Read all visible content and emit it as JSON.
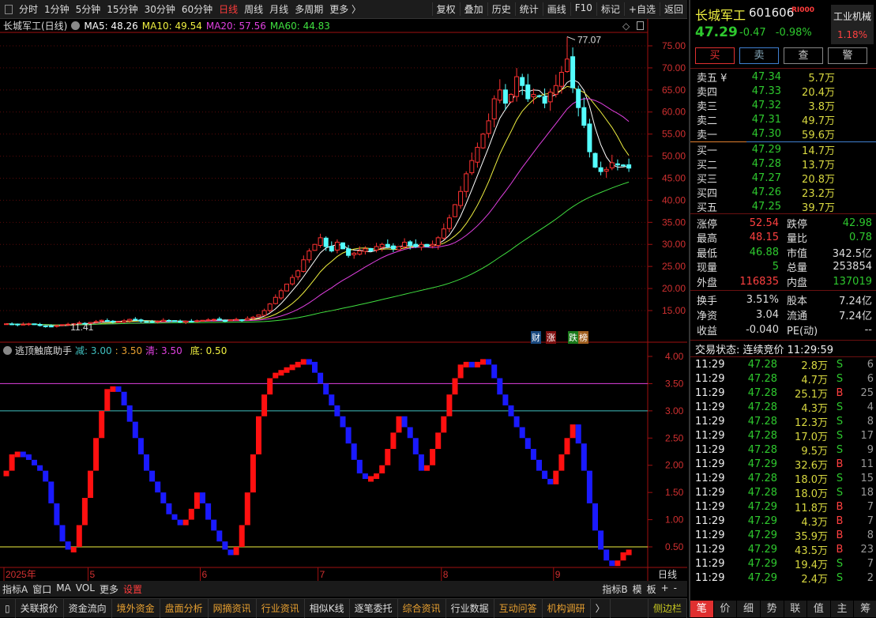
{
  "toolbar": {
    "periods": [
      "分时",
      "1分钟",
      "5分钟",
      "15分钟",
      "30分钟",
      "60分钟",
      "日线",
      "周线",
      "月线",
      "多周期",
      "更多 〉"
    ],
    "active": "日线",
    "actions": [
      "复权",
      "叠加",
      "历史",
      "统计",
      "画线",
      "F10",
      "标记",
      "+自选",
      "返回"
    ]
  },
  "title": {
    "name": "长城军工(日线)",
    "ma5": "MA5: 48.26",
    "ma10": "MA10: 49.54",
    "ma20": "MA20: 57.56",
    "ma60": "MA60: 44.83"
  },
  "indicator": {
    "name": "逃顶触底助手",
    "jian": "减: 3.00",
    "sep": ": 3.50",
    "qing": "清: 3.50",
    "di": "底: 0.50"
  },
  "badges": [
    "财",
    "涨",
    "跌",
    "榜"
  ],
  "colors": {
    "up": "#ff3232",
    "down": "#54ffff",
    "ma5": "#ffffff",
    "ma10": "#f0f040",
    "ma20": "#e040e0",
    "ma60": "#40e040",
    "axis": "#a01010"
  },
  "chart_data": [
    {
      "type": "candlestick",
      "title": "长城军工(日线)",
      "yticks": [
        75,
        70,
        65,
        60,
        55,
        50,
        45,
        40,
        35,
        30,
        25,
        20,
        15
      ],
      "ylim": [
        15,
        75
      ],
      "date_labels": [
        {
          "i": 0,
          "label": "2025年"
        },
        {
          "i": 15,
          "label": "5"
        },
        {
          "i": 35,
          "label": "6"
        },
        {
          "i": 56,
          "label": "7"
        },
        {
          "i": 78,
          "label": "8"
        },
        {
          "i": 98,
          "label": "9"
        }
      ],
      "period_label": "日线",
      "max_label": "77.07",
      "max_value": 77.07,
      "max_index": 100,
      "min_label": "11.41",
      "min_value": 11.41,
      "min_index": 12,
      "close": [
        12.0,
        11.9,
        11.8,
        11.9,
        12.0,
        11.8,
        11.6,
        11.5,
        11.4,
        11.6,
        11.8,
        11.9,
        12.0,
        12.2,
        12.1,
        12.3,
        12.5,
        12.8,
        12.6,
        12.4,
        12.5,
        12.7,
        13.0,
        12.8,
        12.6,
        12.5,
        12.4,
        12.6,
        12.8,
        12.7,
        12.5,
        12.4,
        12.6,
        12.5,
        12.7,
        12.8,
        12.9,
        13.0,
        12.8,
        12.7,
        12.9,
        13.0,
        12.9,
        13.2,
        13.5,
        14.0,
        15.0,
        16.5,
        18.0,
        19.5,
        21.0,
        22.5,
        24.0,
        26.5,
        28.5,
        30.0,
        31.5,
        29.5,
        28.5,
        30.5,
        29.0,
        27.5,
        28.0,
        28.5,
        29.0,
        28.5,
        29.5,
        30.0,
        29.5,
        29.0,
        29.5,
        30.5,
        29.8,
        29.5,
        30.0,
        29.5,
        30.0,
        31.5,
        33.5,
        36.0,
        39.0,
        42.0,
        46.0,
        49.0,
        52.0,
        55.0,
        58.0,
        63.0,
        65.0,
        62.0,
        64.0,
        68.0,
        66.0,
        63.0,
        64.0,
        63.5,
        62.0,
        64.5,
        66.0,
        69.0,
        72.0,
        65.5,
        61.0,
        57.0,
        51.0,
        47.5,
        46.5,
        47.0,
        48.5,
        48.0,
        47.8,
        47.29
      ]
    },
    {
      "type": "step",
      "title": "逃顶触底助手",
      "yticks": [
        4.0,
        3.5,
        3.0,
        2.5,
        2.0,
        1.5,
        1.0,
        0.5
      ],
      "ylim": [
        0.2,
        4.1
      ],
      "hlines": [
        {
          "v": 3.5,
          "color": "#e040e0"
        },
        {
          "v": 3.0,
          "color": "#40c0c0"
        },
        {
          "v": 0.5,
          "color": "#f0f040"
        }
      ],
      "values": [
        1.9,
        2.2,
        2.25,
        2.2,
        2.1,
        2.0,
        1.9,
        1.7,
        1.3,
        0.9,
        0.6,
        0.45,
        0.5,
        0.9,
        1.4,
        1.9,
        2.5,
        3.0,
        3.4,
        3.45,
        3.35,
        3.1,
        2.8,
        2.5,
        2.2,
        1.9,
        1.7,
        1.5,
        1.3,
        1.1,
        1.0,
        0.95,
        1.0,
        1.2,
        1.5,
        1.3,
        1.0,
        0.8,
        0.6,
        0.45,
        0.35,
        0.5,
        0.9,
        1.5,
        2.2,
        2.9,
        3.3,
        3.6,
        3.7,
        3.75,
        3.8,
        3.85,
        3.9,
        3.95,
        3.9,
        3.7,
        3.5,
        3.3,
        3.1,
        2.9,
        2.7,
        2.4,
        2.1,
        1.85,
        1.75,
        1.8,
        1.85,
        2.0,
        2.3,
        2.6,
        2.9,
        2.7,
        2.5,
        2.2,
        1.9,
        2.0,
        2.3,
        2.6,
        2.9,
        3.3,
        3.6,
        3.85,
        3.9,
        3.85,
        3.9,
        3.95,
        3.85,
        3.6,
        3.3,
        3.1,
        2.9,
        2.7,
        2.5,
        2.3,
        2.1,
        1.9,
        1.75,
        1.65,
        1.9,
        2.2,
        2.5,
        2.75,
        2.4,
        1.9,
        1.3,
        0.8,
        0.45,
        0.25,
        0.2,
        0.25,
        0.4,
        0.45
      ]
    }
  ],
  "indbar": {
    "left": [
      "指标A",
      "窗口",
      "MA",
      "VOL",
      "更多",
      "设置"
    ],
    "right": [
      "指标B",
      "模",
      "板",
      "+",
      "-"
    ]
  },
  "bottombar": {
    "items": [
      "关联报价",
      "资金流向",
      "境外资金",
      "盘面分析",
      "网摘资讯",
      "行业资讯",
      "相似K线",
      "逐笔委托",
      "综合资讯",
      "行业数据",
      "互动问答",
      "机构调研",
      "〉"
    ],
    "side": "侧边栏"
  },
  "quote": {
    "name": "长城军工",
    "code": "601606",
    "r_logo": "RI000",
    "industry": "工业机械",
    "industry_chg": "1.18%",
    "price": "47.29",
    "change": "-0.47",
    "pct": "-0.98%",
    "buttons": [
      "买",
      "卖",
      "查",
      "警"
    ],
    "asks": [
      [
        "卖五 ¥",
        "47.34",
        "5.7万"
      ],
      [
        "卖四",
        "47.33",
        "20.4万"
      ],
      [
        "卖三",
        "47.32",
        "3.8万"
      ],
      [
        "卖二",
        "47.31",
        "49.7万"
      ],
      [
        "卖一",
        "47.30",
        "59.6万"
      ]
    ],
    "bids": [
      [
        "买一",
        "47.29",
        "14.7万"
      ],
      [
        "买二",
        "47.28",
        "13.7万"
      ],
      [
        "买三",
        "47.27",
        "20.8万"
      ],
      [
        "买四",
        "47.26",
        "23.2万"
      ],
      [
        "买五",
        "47.25",
        "39.7万"
      ]
    ],
    "stats": [
      [
        "涨停",
        "52.54",
        "red",
        "跌停",
        "42.98",
        "grn"
      ],
      [
        "最高",
        "48.15",
        "red",
        "量比",
        "0.78",
        "grn"
      ],
      [
        "最低",
        "46.88",
        "grn",
        "市值",
        "342.5亿",
        "wht"
      ],
      [
        "现量",
        "5",
        "grn",
        "总量",
        "253854",
        "wht"
      ],
      [
        "外盘",
        "116835",
        "red",
        "内盘",
        "137019",
        "grn"
      ]
    ],
    "stats2": [
      [
        "换手",
        "3.51%",
        "wht",
        "股本",
        "7.24亿",
        "wht"
      ],
      [
        "净资",
        "3.04",
        "wht",
        "流通",
        "7.24亿",
        "wht"
      ],
      [
        "收益",
        "-0.040",
        "wht",
        "PE(动)",
        "--",
        "wht"
      ]
    ],
    "status": "交易状态: 连续竞价 11:29:59",
    "trades": [
      [
        "11:29",
        "47.28",
        "2.8万",
        "S",
        "6"
      ],
      [
        "11:29",
        "47.28",
        "4.7万",
        "S",
        "6"
      ],
      [
        "11:29",
        "47.28",
        "25.1万",
        "B",
        "25"
      ],
      [
        "11:29",
        "47.28",
        "4.3万",
        "S",
        "4"
      ],
      [
        "11:29",
        "47.28",
        "12.3万",
        "S",
        "8"
      ],
      [
        "11:29",
        "47.28",
        "17.0万",
        "S",
        "17"
      ],
      [
        "11:29",
        "47.28",
        "9.5万",
        "S",
        "9"
      ],
      [
        "11:29",
        "47.29",
        "32.6万",
        "B",
        "11"
      ],
      [
        "11:29",
        "47.28",
        "18.0万",
        "S",
        "15"
      ],
      [
        "11:29",
        "47.28",
        "18.0万",
        "S",
        "18"
      ],
      [
        "11:29",
        "47.29",
        "11.8万",
        "B",
        "7"
      ],
      [
        "11:29",
        "47.29",
        "4.3万",
        "B",
        "7"
      ],
      [
        "11:29",
        "47.29",
        "35.9万",
        "B",
        "8"
      ],
      [
        "11:29",
        "47.29",
        "43.5万",
        "B",
        "23"
      ],
      [
        "11:29",
        "47.29",
        "19.4万",
        "S",
        "7"
      ],
      [
        "11:29",
        "47.29",
        "2.4万",
        "S",
        "2"
      ]
    ],
    "tabs": [
      "笔",
      "价",
      "细",
      "势",
      "联",
      "值",
      "主",
      "筹"
    ]
  }
}
